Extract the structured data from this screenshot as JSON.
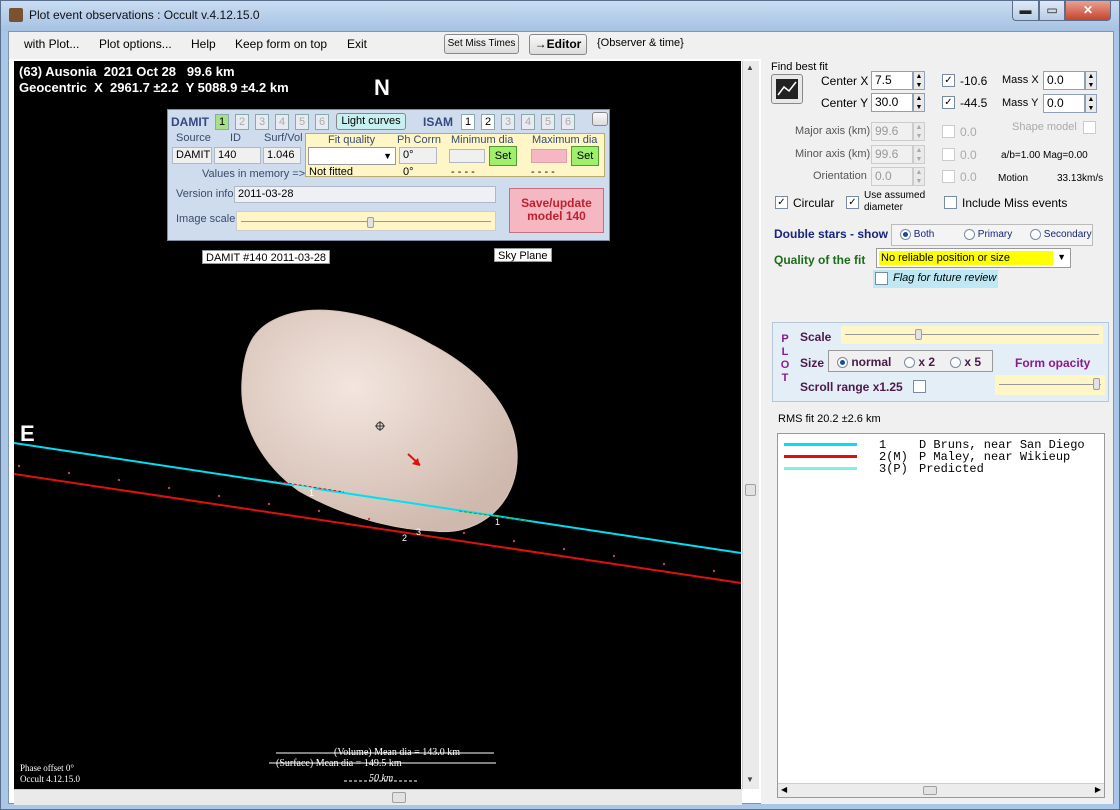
{
  "window": {
    "title": "Plot event observations : Occult v.4.12.15.0",
    "min": "▬",
    "max": "▭",
    "close": "✕"
  },
  "menu": {
    "with_plot": "with Plot...",
    "plot_options": "Plot options...",
    "help": "Help",
    "keep_on_top": "Keep form on top",
    "exit": "Exit",
    "set_miss_times": "Set Miss Times",
    "editor": "→Editor",
    "observer_time": "{Observer & time}"
  },
  "plot": {
    "header_line1": "(63) Ausonia  2021 Oct 28   99.6 km",
    "header_line2": "Geocentric  X  2961.7 ±2.2  Y 5088.9 ±4.2 km",
    "north": "N",
    "east": "E",
    "damit_tag": "DAMIT #140 2011-03-28",
    "sky_plane": "Sky Plane",
    "phase_offset": "Phase offset 0°",
    "version": "Occult 4.12.15.0",
    "volume_mean": "(Volume) Mean dia = 143.0 km",
    "surface_mean": "(Surface) Mean dia = 149.5 km",
    "scale_bar": "50 km",
    "chord_labels": [
      "1",
      "2",
      "3",
      "1"
    ]
  },
  "damit_panel": {
    "damit_label": "DAMIT",
    "damit_numbers": [
      "1",
      "2",
      "3",
      "4",
      "5",
      "6"
    ],
    "light_curves": "Light curves",
    "isam_label": "ISAM",
    "isam_numbers": [
      "1",
      "2",
      "3",
      "4",
      "5",
      "6"
    ],
    "col_source": "Source",
    "col_id": "ID",
    "col_surf_vol": "Surf/Vol",
    "source": "DAMIT",
    "id": "140",
    "surf_vol": "1.046",
    "fit_quality": "Fit quality",
    "ph_corr": "Ph Corrn",
    "min_dia": "Minimum dia",
    "max_dia": "Maximum dia",
    "ph_corr_val": "0°",
    "values_in_memory": "Values in memory =>",
    "not_fitted": "Not fitted",
    "ph_corr_val2": "0°",
    "dash1": "- - - -",
    "dash2": "- - - -",
    "set": "Set",
    "version_info_label": "Version info",
    "version_info": "2011-03-28",
    "image_scale": "Image scale",
    "save_update": "Save/update model 140"
  },
  "side": {
    "find_best_fit": "Find best fit",
    "center_x_label": "Center X",
    "center_x": "7.5",
    "center_y_label": "Center Y",
    "center_y": "30.0",
    "cx_val": "-10.6",
    "cy_val": "-44.5",
    "mass_x_label": "Mass X",
    "mass_x": "0.0",
    "mass_y_label": "Mass Y",
    "mass_y": "0.0",
    "major_label": "Major axis (km)",
    "major": "99.6",
    "minor_label": "Minor axis (km)",
    "minor": "99.6",
    "orient_label": "Orientation",
    "orient": "0.0",
    "zero1": "0.0",
    "zero2": "0.0",
    "zero3": "0.0",
    "shape_model": "Shape model",
    "ab_mag": "a/b=1.00  Mag=0.00",
    "motion_label": "Motion",
    "motion": "33.13km/s",
    "circular": "Circular",
    "use_assumed": "Use assumed diameter",
    "include_miss": "Include Miss events",
    "double_stars": "Double stars - show",
    "both": "Both",
    "primary": "Primary",
    "secondary": "Secondary",
    "quality_label": "Quality of the fit",
    "quality_value": "No reliable position or size",
    "flag_review": "Flag for future review",
    "plot_letters": [
      "P",
      "L",
      "O",
      "T"
    ],
    "scale": "Scale",
    "size": "Size",
    "normal": "normal",
    "x2": "x 2",
    "x5": "x 5",
    "form_opacity": "Form opacity",
    "scroll_range": "Scroll range x1.25",
    "rms_fit": "RMS fit 20.2 ±2.6 km",
    "legend": [
      {
        "num": "1",
        "name": "D Bruns, near San Diego",
        "color": "#00e0f0"
      },
      {
        "num": "2(M)",
        "name": "P Maley, near Wikieup",
        "color": "#e01010"
      },
      {
        "num": "3(P)",
        "name": "Predicted",
        "color": "#80f0e0"
      }
    ]
  }
}
